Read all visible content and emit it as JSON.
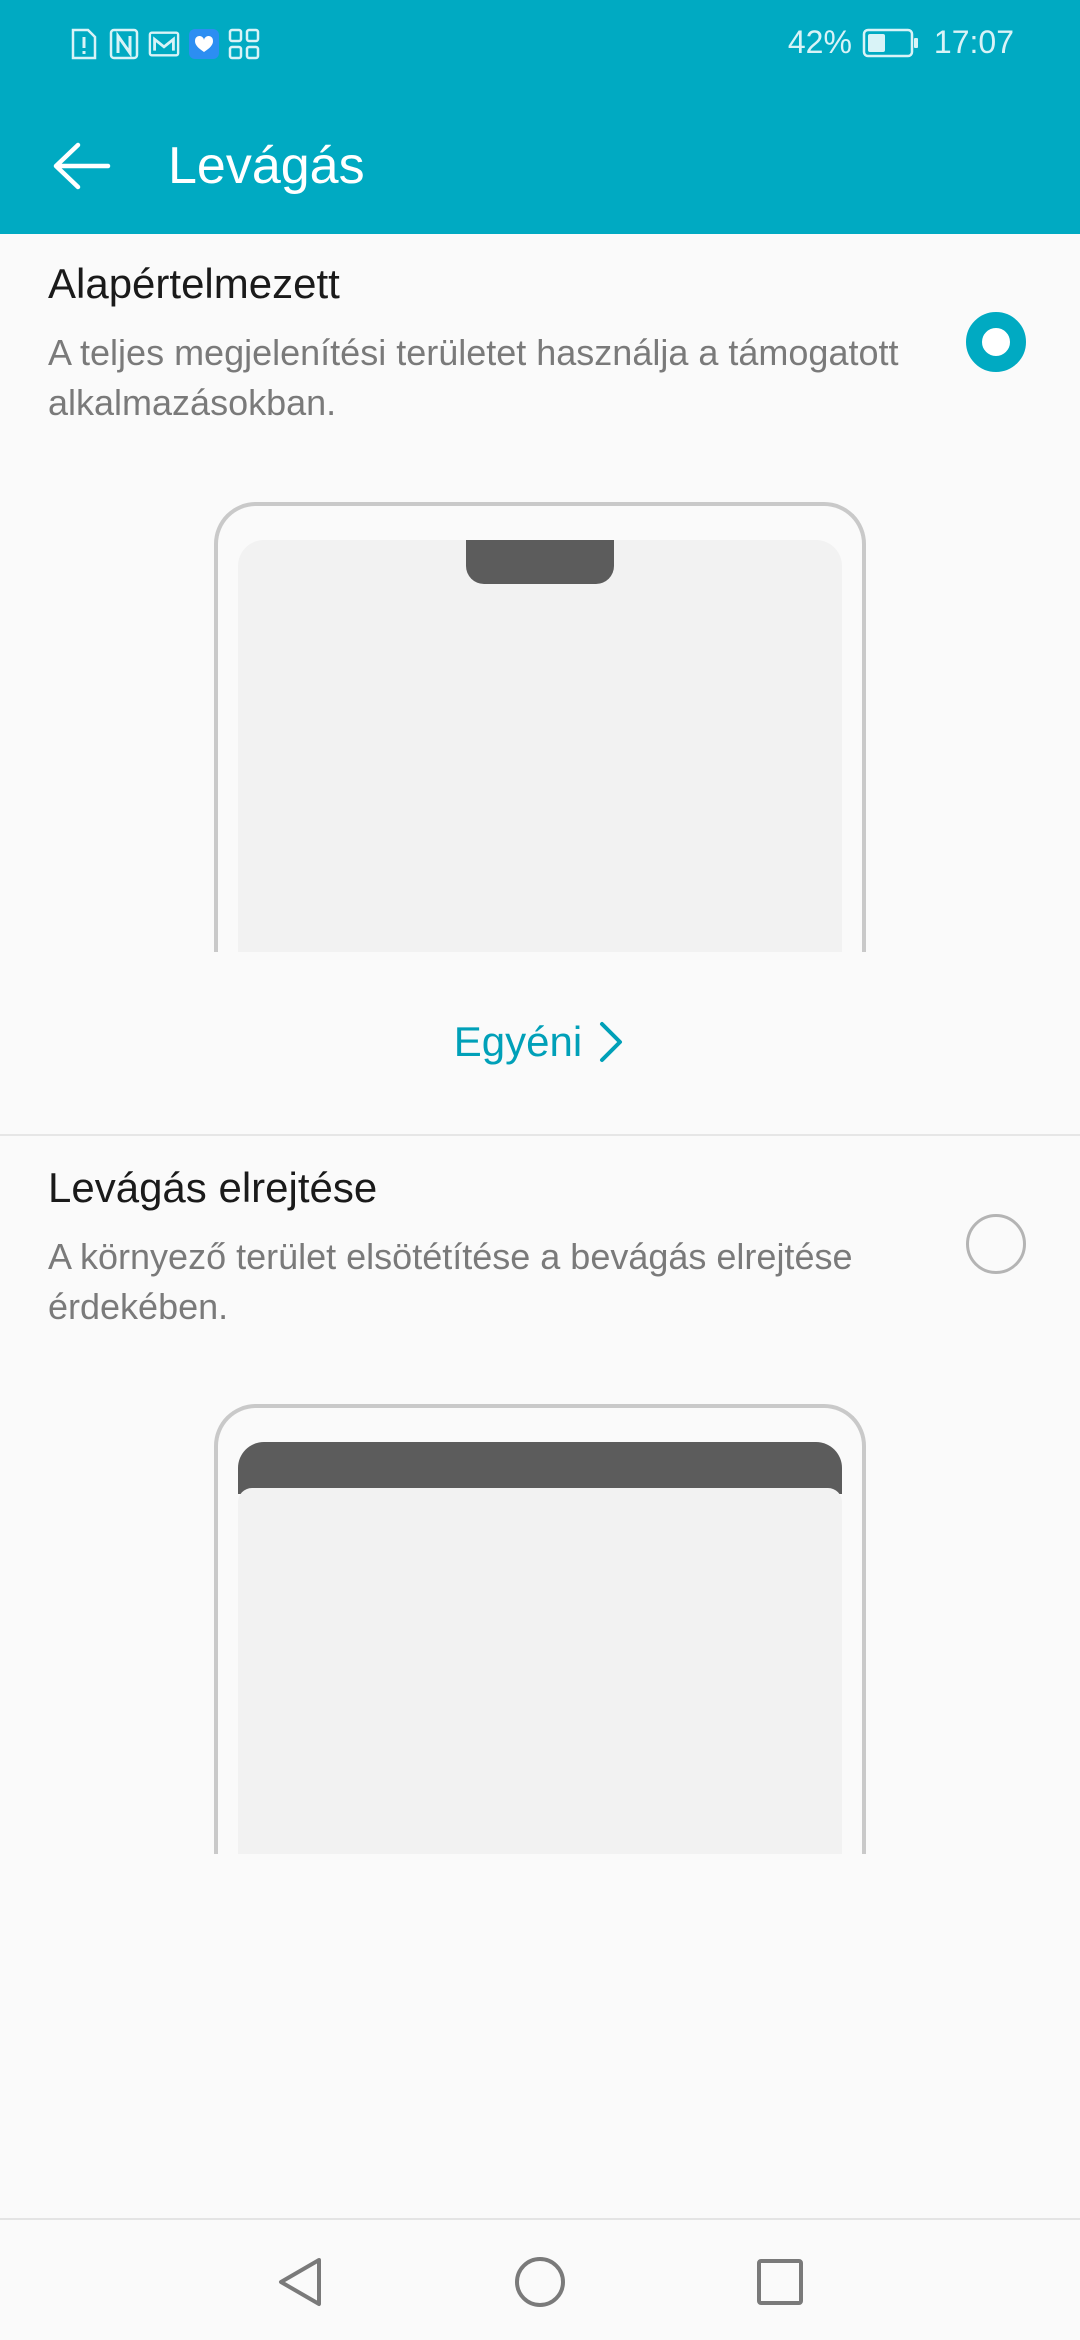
{
  "status_bar": {
    "battery_percent": "42%",
    "battery_level": 0.42,
    "time": "17:07",
    "notification_icons": [
      "alert-sim-icon",
      "nfc-icon",
      "gmail-icon",
      "health-app-icon",
      "apps-grid-icon"
    ]
  },
  "toolbar": {
    "title": "Levágás",
    "back_icon": "arrow-left-icon"
  },
  "options": [
    {
      "title": "Alapértelmezett",
      "description": "A teljes megjelenítési területet használja a támogatott alkalmazásokban.",
      "selected": true,
      "illustration": "notch-visible"
    },
    {
      "title": "Levágás elrejtése",
      "description": "A környező terület elsötétítése a bevágás elrejtése érdekében.",
      "selected": false,
      "illustration": "notch-hidden"
    }
  ],
  "custom_link": {
    "label": "Egyéni"
  },
  "nav_bar": {
    "buttons": [
      "back-triangle-icon",
      "home-circle-icon",
      "recents-square-icon"
    ]
  },
  "colors": {
    "accent": "#00aac2",
    "link": "#00a0b8",
    "notch": "#5c5c5c"
  }
}
